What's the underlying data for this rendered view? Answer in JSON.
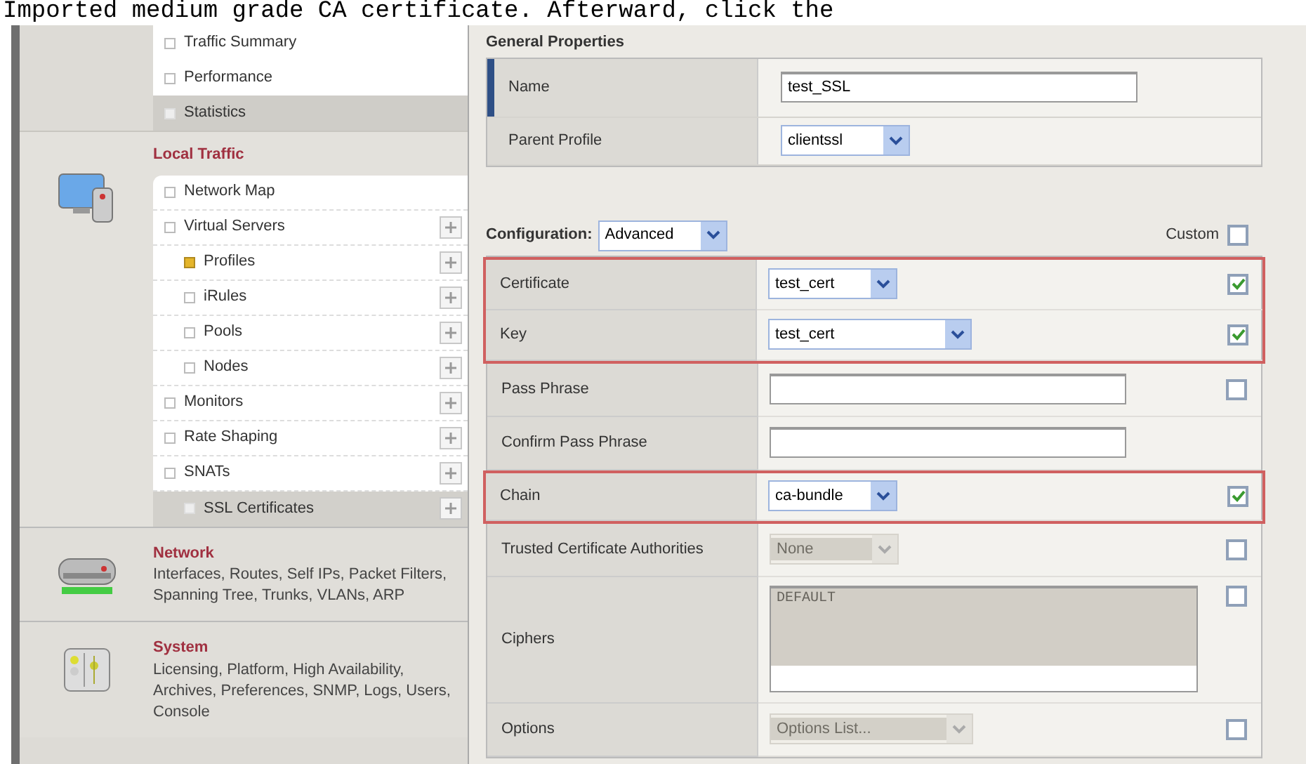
{
  "caption": "Imported medium grade CA certificate. Afterward, click the",
  "sidebar": {
    "overview": [
      {
        "label": "Traffic Summary",
        "selected": false
      },
      {
        "label": "Performance",
        "selected": false
      },
      {
        "label": "Statistics",
        "selected": true
      }
    ],
    "sections": [
      {
        "title": "Local Traffic",
        "kind": "menu",
        "items": [
          {
            "label": "Network Map",
            "addable": false,
            "selected": false
          },
          {
            "label": "Virtual Servers",
            "addable": true,
            "selected": false,
            "children": [
              {
                "label": "Profiles",
                "addable": true,
                "selected": true
              },
              {
                "label": "iRules",
                "addable": true,
                "selected": false
              },
              {
                "label": "Pools",
                "addable": true,
                "selected": false
              },
              {
                "label": "Nodes",
                "addable": true,
                "selected": false
              }
            ]
          },
          {
            "label": "Monitors",
            "addable": true,
            "selected": false
          },
          {
            "label": "Rate Shaping",
            "addable": true,
            "selected": false
          },
          {
            "label": "SNATs",
            "addable": true,
            "selected": false
          }
        ],
        "footer": {
          "label": "SSL Certificates",
          "addable": true
        }
      },
      {
        "title": "Network",
        "kind": "summary",
        "description": "Interfaces, Routes, Self IPs, Packet Filters, Spanning Tree, Trunks, VLANs, ARP"
      },
      {
        "title": "System",
        "kind": "summary",
        "description": "Licensing, Platform, High Availability, Archives, Preferences, SNMP, Logs, Users, Console"
      }
    ]
  },
  "general": {
    "title": "General Properties",
    "rows": [
      {
        "label": "Name",
        "kind": "text",
        "value": "test_SSL",
        "focused": true
      },
      {
        "label": "Parent Profile",
        "kind": "select",
        "value": "clientssl",
        "focused": false
      }
    ]
  },
  "configuration": {
    "label": "Configuration:",
    "mode": "Advanced",
    "custom_label": "Custom",
    "custom_checked": false,
    "rows": [
      {
        "label": "Certificate",
        "kind": "select",
        "value": "test_cert",
        "wide": false,
        "disabled": false,
        "checked": true,
        "highlighted": true
      },
      {
        "label": "Key",
        "kind": "select",
        "value": "test_cert",
        "wide": true,
        "disabled": false,
        "checked": true,
        "highlighted": true
      },
      {
        "label": "Pass Phrase",
        "kind": "text",
        "value": "",
        "disabled": false,
        "checked": false,
        "highlighted": false
      },
      {
        "label": "Confirm Pass Phrase",
        "kind": "text",
        "value": "",
        "disabled": false,
        "highlighted": false
      },
      {
        "label": "Chain",
        "kind": "select",
        "value": "ca-bundle",
        "wide": false,
        "disabled": false,
        "checked": true,
        "highlighted": true
      },
      {
        "label": "Trusted Certificate Authorities",
        "kind": "select",
        "value": "None",
        "wide": false,
        "disabled": true,
        "checked": false,
        "highlighted": false
      },
      {
        "label": "Ciphers",
        "kind": "textarea",
        "value": "DEFAULT",
        "disabled": true,
        "checked": false,
        "highlighted": false
      },
      {
        "label": "Options",
        "kind": "select",
        "value": "Options List...",
        "wide": true,
        "disabled": true,
        "checked": false,
        "highlighted": false
      }
    ]
  }
}
